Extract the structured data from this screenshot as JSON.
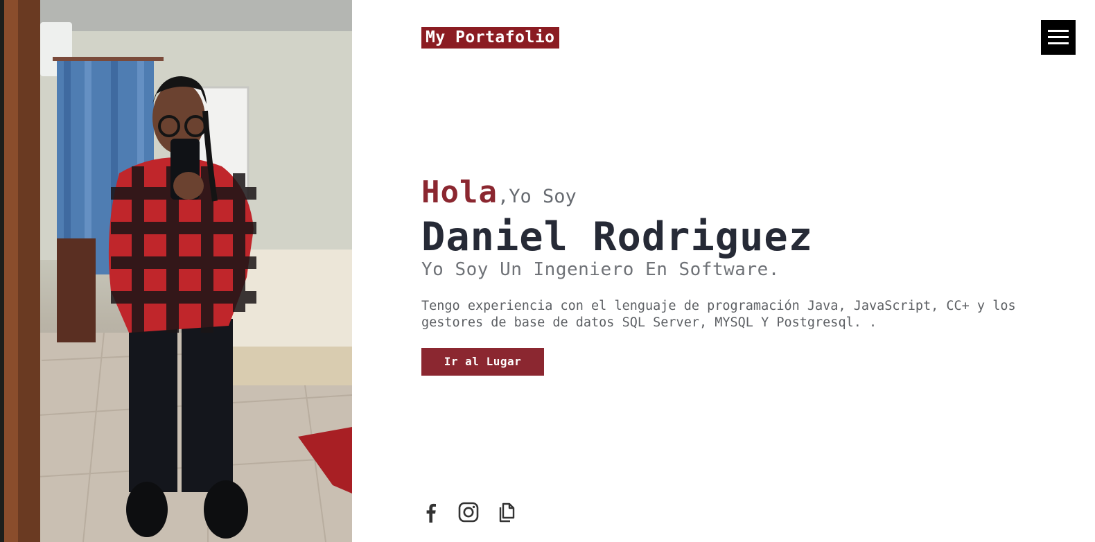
{
  "header": {
    "logo_text": "My Portafolio",
    "menu_icon": "hamburger-menu-icon"
  },
  "hero": {
    "greeting": "Hola",
    "greeting_rest": ",Yo Soy",
    "name": "Daniel Rodriguez",
    "role": "Yo Soy Un Ingeniero En Software.",
    "description": "Tengo experiencia con el lenguaje de programación Java, JavaScript, CC+ y los gestores de base de datos SQL Server, MYSQL Y Postgresql. .",
    "cta_label": "Ir al Lugar"
  },
  "social": {
    "icons": [
      "facebook-icon",
      "instagram-icon",
      "documents-icon"
    ]
  },
  "colors": {
    "accent": "#8b2730",
    "logo_bg": "#8b1c22",
    "heading": "#262a36",
    "menu_bg": "#000000"
  }
}
